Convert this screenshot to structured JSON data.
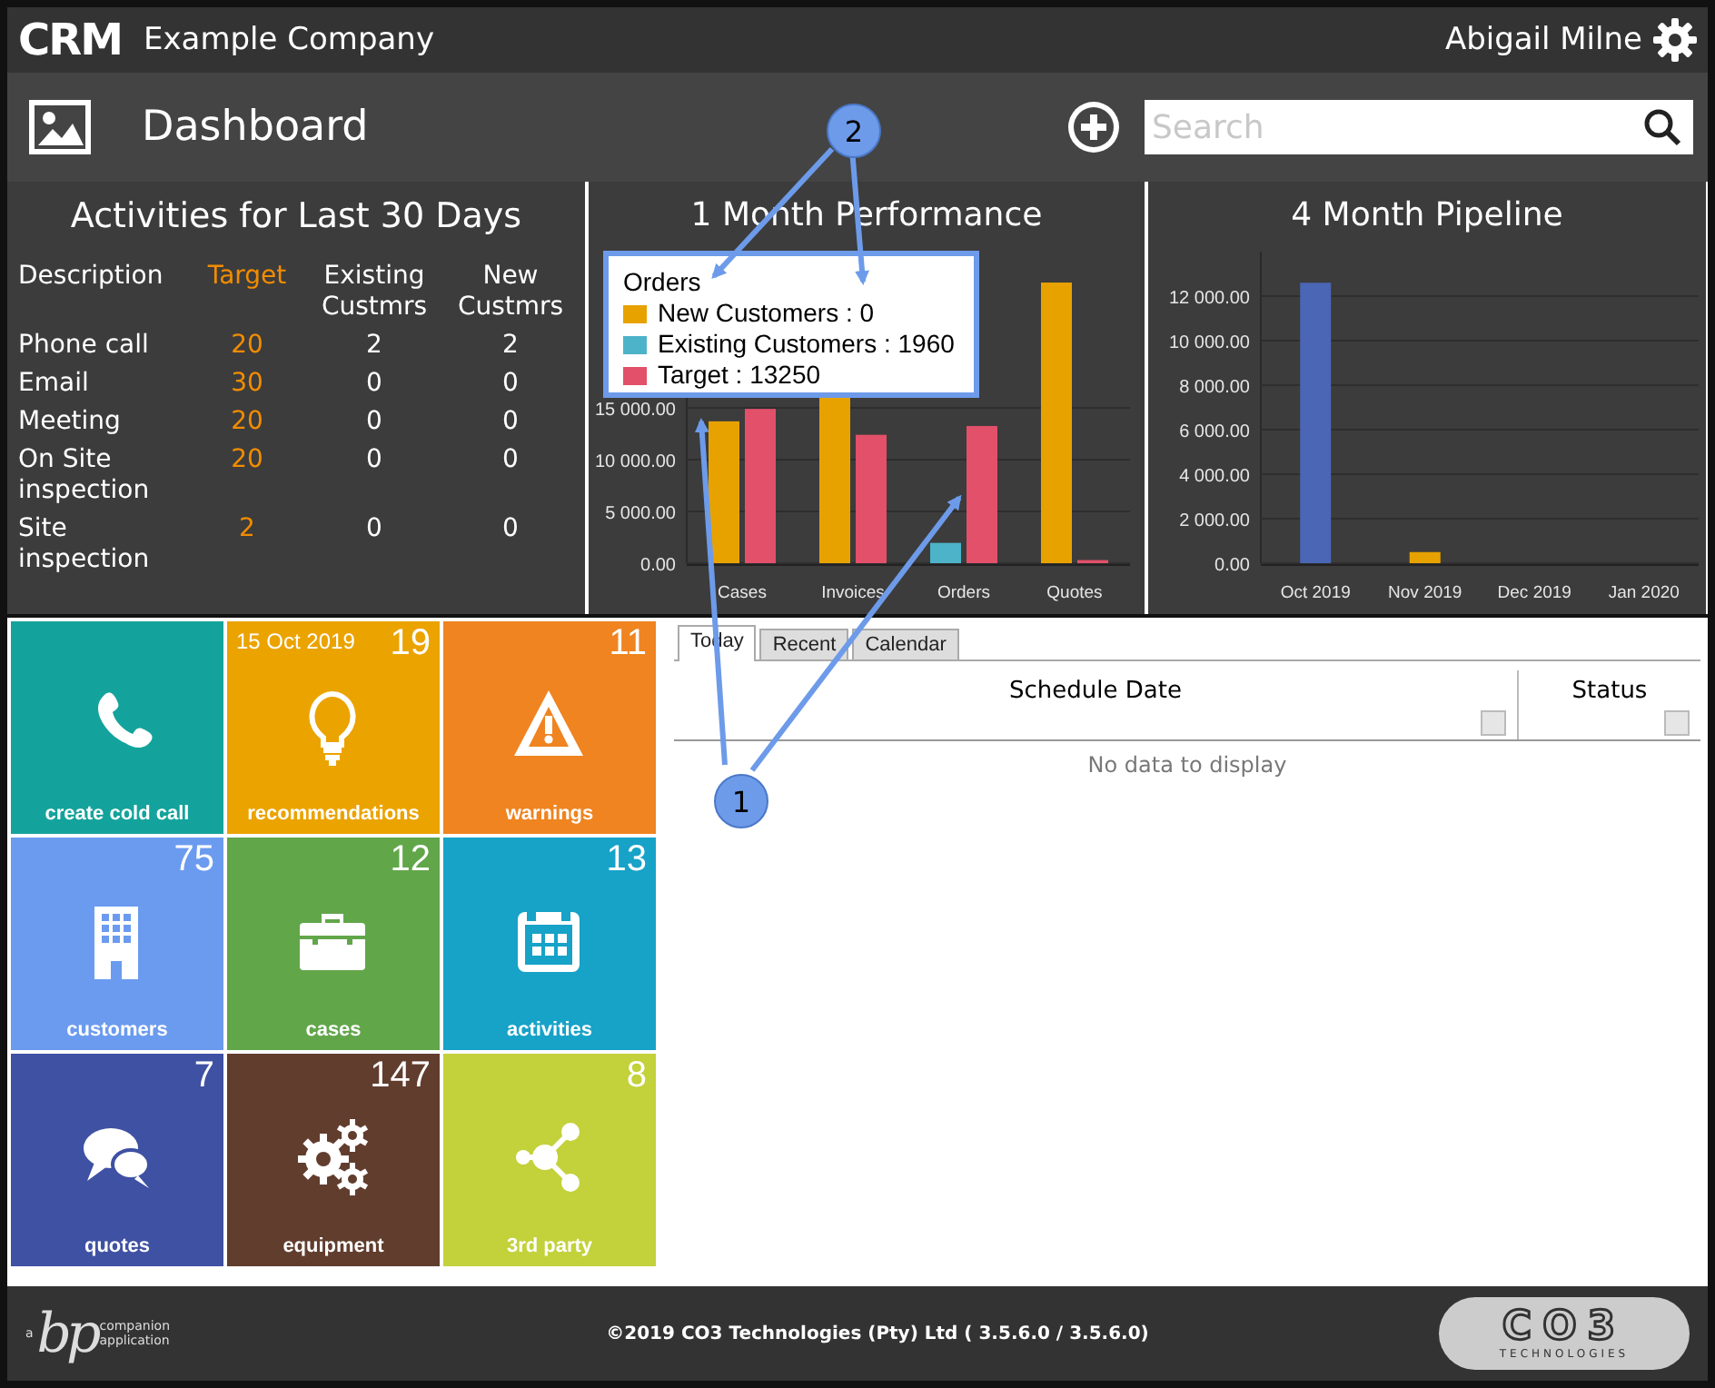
{
  "header": {
    "logo": "CRM",
    "company": "Example Company",
    "user": "Abigail Milne"
  },
  "toolbar": {
    "title": "Dashboard",
    "search": {
      "placeholder": "Search"
    }
  },
  "activities": {
    "title": "Activities for Last 30 Days",
    "columns": [
      "Description",
      "Target",
      "Existing Custmrs",
      "New Custmrs"
    ],
    "rows": [
      [
        "Phone call",
        "20",
        "2",
        "2"
      ],
      [
        "Email",
        "30",
        "0",
        "0"
      ],
      [
        "Meeting",
        "20",
        "0",
        "0"
      ],
      [
        "On Site inspection",
        "20",
        "0",
        "0"
      ],
      [
        "Site inspection",
        "2",
        "0",
        "0"
      ]
    ]
  },
  "performance": {
    "title": "1 Month Performance",
    "chart_data": {
      "type": "bar",
      "grid": true,
      "categories": [
        "Cases",
        "Invoices",
        "Orders",
        "Quotes"
      ],
      "ylim": [
        0,
        30000
      ],
      "yticks": [
        {
          "value": 0,
          "label": "0.00"
        },
        {
          "value": 5000,
          "label": "5 000.00"
        },
        {
          "value": 10000,
          "label": "10 000.00"
        },
        {
          "value": 15000,
          "label": "15 000.00"
        }
      ],
      "series": [
        {
          "color": "#e8a200",
          "values": [
            13700,
            16000,
            0,
            27100
          ]
        },
        {
          "color": "#4db3c9",
          "values": [
            0,
            0,
            1960,
            0
          ]
        },
        {
          "color": "#e2506a",
          "values": [
            14900,
            12400,
            13250,
            300
          ]
        }
      ]
    },
    "tooltip": {
      "title": "Orders",
      "items": [
        {
          "label": "New Customers : 0",
          "color": "#e8a200"
        },
        {
          "label": "Existing Customers : 1960",
          "color": "#4db3c9"
        },
        {
          "label": "Target : 13250",
          "color": "#e2506a"
        }
      ]
    }
  },
  "pipeline": {
    "title": "4 Month Pipeline",
    "chart_data": {
      "type": "bar",
      "grid": true,
      "categories": [
        "Oct 2019",
        "Nov 2019",
        "Dec 2019",
        "Jan 2020"
      ],
      "ylim": [
        0,
        14000
      ],
      "yticks": [
        {
          "value": 0,
          "label": "0.00"
        },
        {
          "value": 2000,
          "label": "2 000.00"
        },
        {
          "value": 4000,
          "label": "4 000.00"
        },
        {
          "value": 6000,
          "label": "6 000.00"
        },
        {
          "value": 8000,
          "label": "8 000.00"
        },
        {
          "value": 10000,
          "label": "10 000.00"
        },
        {
          "value": 12000,
          "label": "12 000.00"
        }
      ],
      "series": [
        {
          "color": "#4a66b5",
          "values": [
            12600,
            0,
            0,
            0
          ]
        },
        {
          "color": "#e8a200",
          "values": [
            0,
            500,
            0,
            0
          ]
        }
      ]
    }
  },
  "tiles": [
    {
      "label": "create cold call",
      "color": "#14a39c"
    },
    {
      "label": "recommendations",
      "count": "19",
      "date": "15 Oct 2019",
      "color": "#eba300"
    },
    {
      "label": "warnings",
      "count": "11",
      "color": "#ef8420"
    },
    {
      "label": "customers",
      "count": "75",
      "color": "#6b9bef"
    },
    {
      "label": "cases",
      "count": "12",
      "color": "#62a64a"
    },
    {
      "label": "activities",
      "count": "13",
      "color": "#17a2c8"
    },
    {
      "label": "quotes",
      "count": "7",
      "color": "#3f51a2"
    },
    {
      "label": "equipment",
      "count": "147",
      "color": "#613d2e"
    },
    {
      "label": "3rd party",
      "count": "8",
      "color": "#c3d13a"
    }
  ],
  "schedule": {
    "tabs": [
      {
        "label": "Today",
        "selected": true
      },
      {
        "label": "Recent",
        "selected": false
      },
      {
        "label": "Calendar",
        "selected": false
      }
    ],
    "columns": [
      "Schedule Date",
      "Status"
    ],
    "empty": "No data to display"
  },
  "footer": {
    "bp_logo": "bp",
    "bp_prefix": "a",
    "bp_caption": "companion application",
    "copyright": "©2019 CO3 Technologies (Pty) Ltd ( 3.5.6.0 / 3.5.6.0)",
    "co3_logo": "CO3",
    "co3_caption": "TECHNOLOGIES"
  },
  "callouts": [
    {
      "label": "2"
    },
    {
      "label": "1"
    }
  ]
}
